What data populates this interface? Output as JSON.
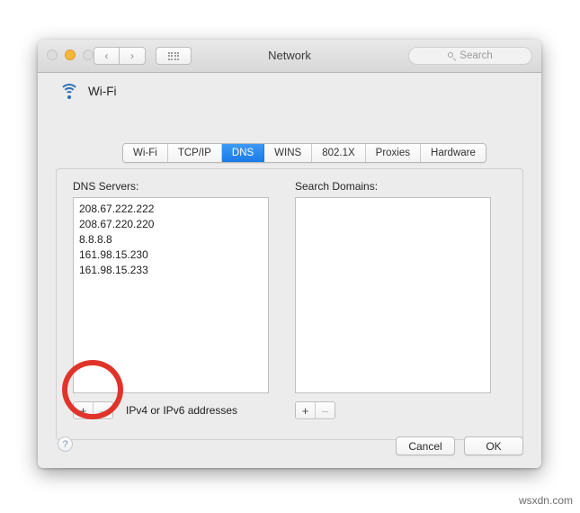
{
  "window": {
    "title": "Network",
    "traffic_lights": [
      {
        "name": "close",
        "state": "inactive",
        "color": "#dcdcdc"
      },
      {
        "name": "minimize",
        "state": "active",
        "color": "#f6b73c"
      },
      {
        "name": "zoom",
        "state": "inactive",
        "color": "#dcdcdc"
      }
    ],
    "nav_back": "‹",
    "nav_forward": "›",
    "search": {
      "placeholder": "Search",
      "value": "",
      "icon": "search-icon"
    }
  },
  "service": {
    "icon": "wifi-icon",
    "name": "Wi-Fi"
  },
  "tabs": [
    {
      "label": "Wi-Fi",
      "active": false
    },
    {
      "label": "TCP/IP",
      "active": false
    },
    {
      "label": "DNS",
      "active": true
    },
    {
      "label": "WINS",
      "active": false
    },
    {
      "label": "802.1X",
      "active": false
    },
    {
      "label": "Proxies",
      "active": false
    },
    {
      "label": "Hardware",
      "active": false
    }
  ],
  "dns": {
    "label": "DNS Servers:",
    "servers": [
      "208.67.222.222",
      "208.67.220.220",
      "8.8.8.8",
      "161.98.15.230",
      "161.98.15.233"
    ],
    "add_label": "+",
    "remove_label": "–",
    "hint": "IPv4 or IPv6 addresses"
  },
  "search_domains": {
    "label": "Search Domains:",
    "entries": [],
    "add_label": "+",
    "remove_label": "–"
  },
  "footer": {
    "help_label": "?",
    "cancel_label": "Cancel",
    "ok_label": "OK"
  },
  "annotation": {
    "shape": "circle",
    "color": "#e0342a",
    "target": "dns-add-remove-buttons"
  },
  "watermark": "wsxdn.com",
  "colors": {
    "accent": "#1a7ae8",
    "wifi_icon": "#2b6fb5",
    "annotation": "#e0342a",
    "window_bg": "#ececec"
  }
}
